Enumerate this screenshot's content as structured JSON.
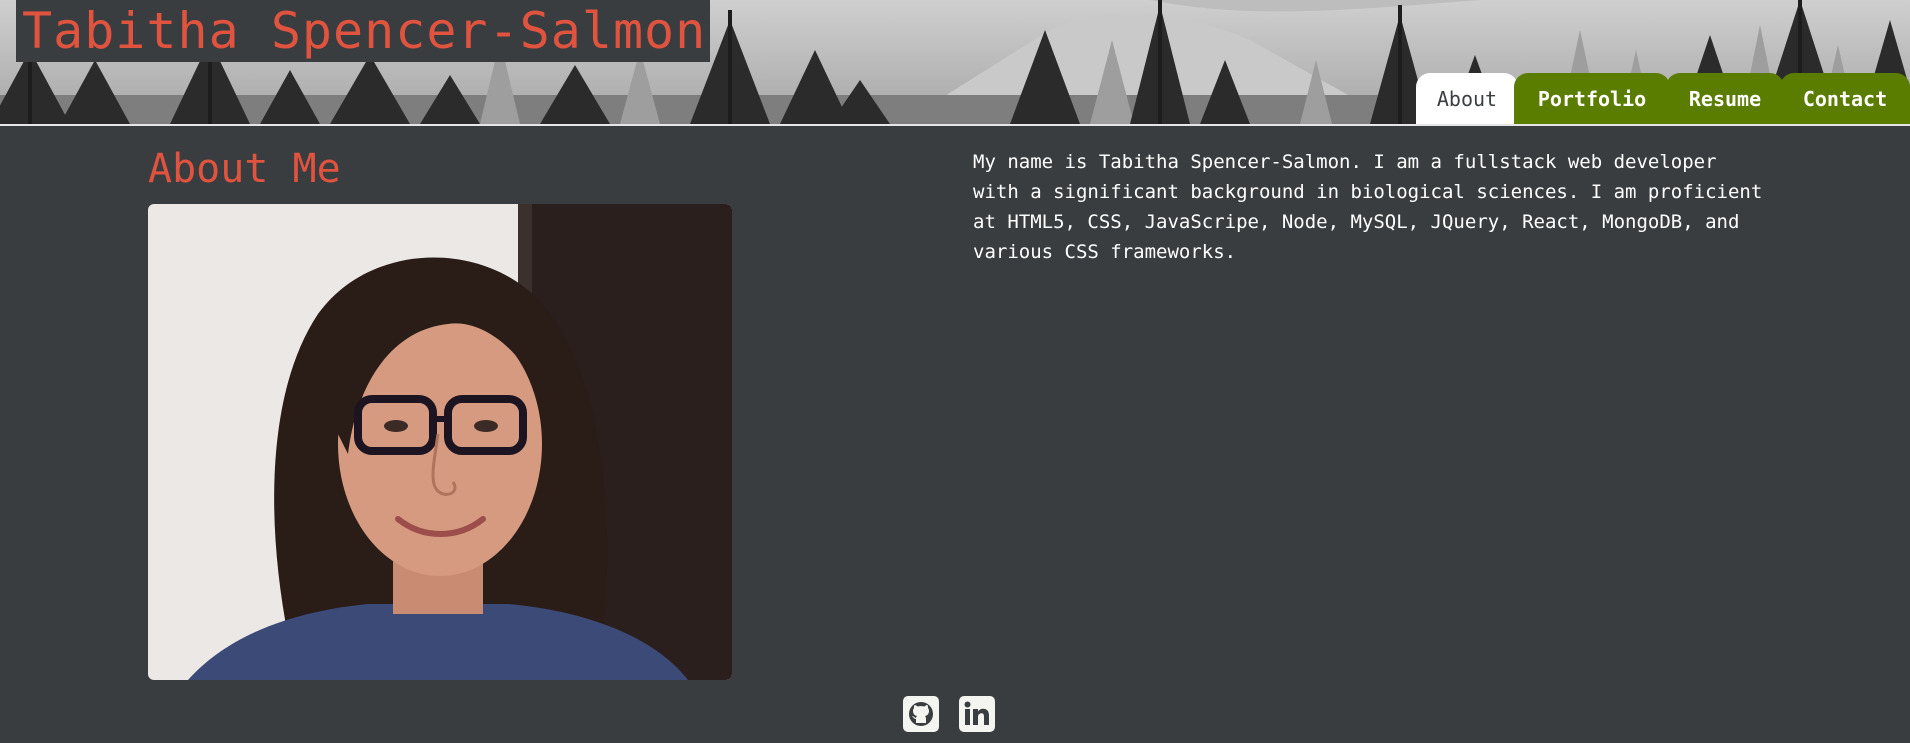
{
  "header": {
    "site_title": "Tabitha Spencer-Salmon"
  },
  "nav": {
    "tabs": [
      {
        "label": "About",
        "active": true
      },
      {
        "label": "Portfolio",
        "active": false
      },
      {
        "label": "Resume",
        "active": false
      },
      {
        "label": "Contact",
        "active": false
      }
    ]
  },
  "about": {
    "heading": "About Me",
    "bio": "My name is Tabitha Spencer-Salmon. I am a fullstack web developer with a significant background in biological sciences. I am proficient at HTML5, CSS, JavaScripe, Node, MySQL, JQuery, React, MongoDB, and various CSS frameworks."
  },
  "social": {
    "icons": [
      "github-icon",
      "linkedin-icon"
    ]
  },
  "colors": {
    "background": "#393d40",
    "accent": "#e0533f",
    "tab_green": "#5a7d00",
    "tab_active": "#ffffff"
  }
}
